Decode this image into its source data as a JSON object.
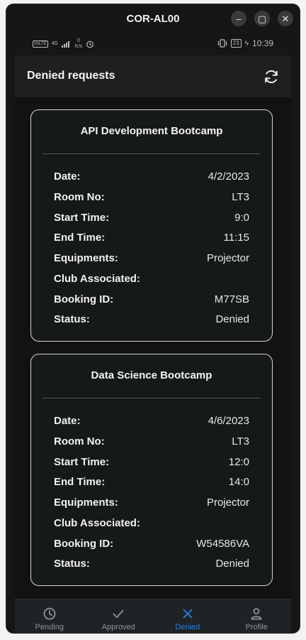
{
  "window": {
    "title": "COR-AL00",
    "minimize": "–",
    "maximize": "▢",
    "close": "✕"
  },
  "status_bar": {
    "volte": "VoLTE",
    "network": "4G",
    "speed_value": "0",
    "speed_unit": "K/s",
    "battery": "23",
    "time": "10:39"
  },
  "appbar": {
    "title": "Denied requests",
    "refresh_icon": "refresh-icon"
  },
  "labels": {
    "date": "Date:",
    "room": "Room No:",
    "start": "Start Time:",
    "end": "End Time:",
    "equip": "Equipments:",
    "club": "Club Associated:",
    "booking": "Booking ID:",
    "status": "Status:"
  },
  "requests": [
    {
      "title": "API Development Bootcamp",
      "date": "4/2/2023",
      "room": "LT3",
      "start": "9:0",
      "end": "11:15",
      "equip": "Projector",
      "club": "",
      "booking": "M77SB",
      "status": "Denied"
    },
    {
      "title": "Data Science Bootcamp",
      "date": "4/6/2023",
      "room": "LT3",
      "start": "12:0",
      "end": "14:0",
      "equip": "Projector",
      "club": "",
      "booking": "W54586VA",
      "status": "Denied"
    }
  ],
  "nav": [
    {
      "label": "Pending",
      "icon": "clock-icon",
      "active": false
    },
    {
      "label": "Approved",
      "icon": "check-icon",
      "active": false
    },
    {
      "label": "Denied",
      "icon": "close-icon",
      "active": true
    },
    {
      "label": "Profile",
      "icon": "person-icon",
      "active": false
    }
  ],
  "colors": {
    "active": "#2a7fe6",
    "inactive": "#8d949a",
    "card_border": "#d6d6d6"
  }
}
